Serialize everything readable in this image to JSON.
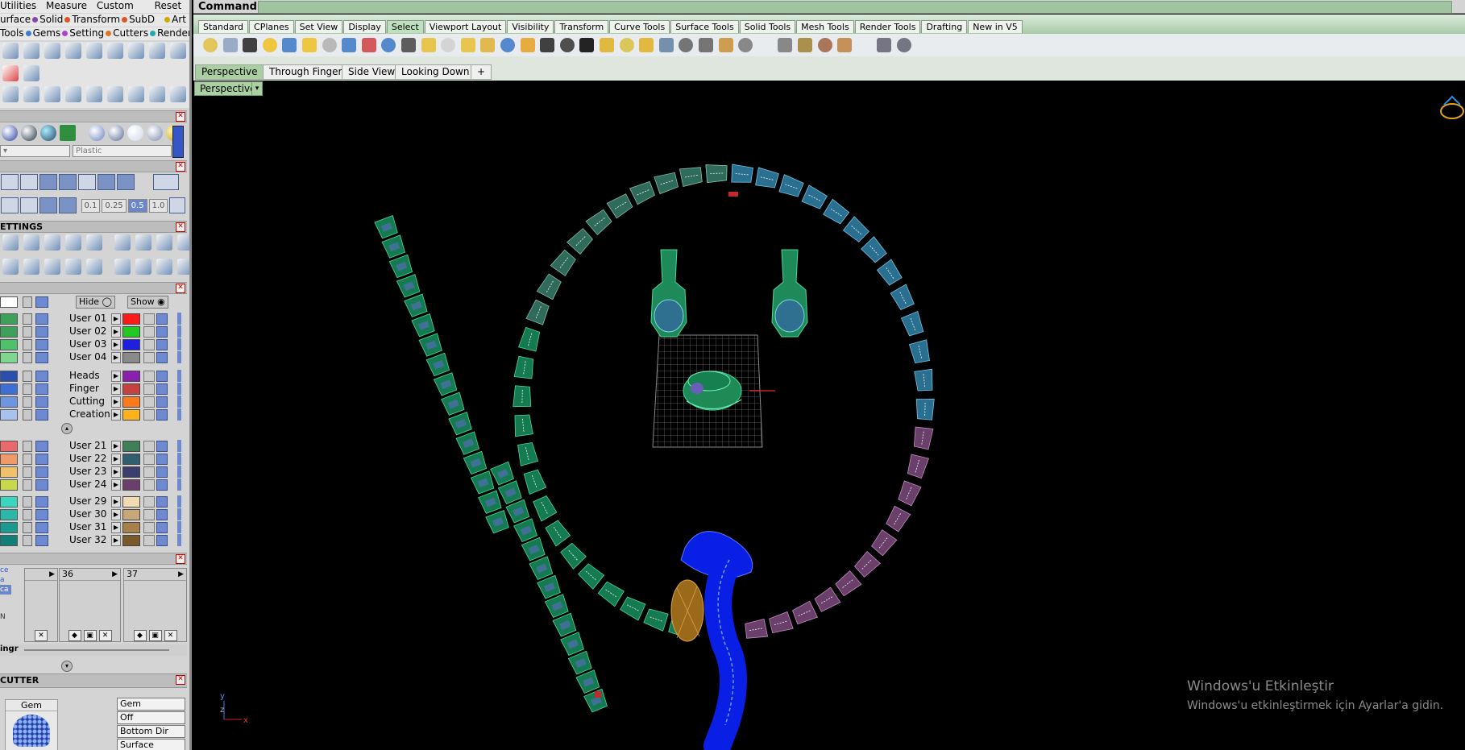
{
  "menu": {
    "row1": [
      "Utilities",
      "Measure",
      "Custom",
      "Reset"
    ],
    "row2": [
      "urface",
      "Solid",
      "Transform",
      "SubD",
      "Art"
    ],
    "row3": [
      "Tools",
      "Gems",
      "Setting",
      "Cutters",
      "Render"
    ]
  },
  "material": {
    "dropdown2": "Plastic"
  },
  "snap": {
    "values": [
      "0.1",
      "0.25",
      "0.5",
      "1.0"
    ],
    "selected": "0.5"
  },
  "sections": {
    "settings": "ETTINGS",
    "cutter": "CUTTER"
  },
  "layers": {
    "hide": "Hide",
    "show": "Show",
    "rows": [
      {
        "name": "User 01",
        "color": "#ff1a1a",
        "chip": "#3fa05a"
      },
      {
        "name": "User 02",
        "color": "#22c922",
        "chip": "#3fa05a"
      },
      {
        "name": "User 03",
        "color": "#1f1fe0",
        "chip": "#4fc16b"
      },
      {
        "name": "User 04",
        "color": "#8a8a8a",
        "chip": "#7fd68f"
      },
      {
        "name": "Heads",
        "color": "#8a1fb0",
        "chip": "#2b4fae"
      },
      {
        "name": "Finger",
        "color": "#c84040",
        "chip": "#3e6fd4"
      },
      {
        "name": "Cutting",
        "color": "#ff7a1a",
        "chip": "#6d95e2"
      },
      {
        "name": "Creation",
        "color": "#ffb21a",
        "chip": "#a8c2f0"
      },
      {
        "name": "User 21",
        "color": "#3f7f5a",
        "chip": "#e86a6a"
      },
      {
        "name": "User 22",
        "color": "#2f5f6f",
        "chip": "#f09a6a"
      },
      {
        "name": "User 23",
        "color": "#3a3f6f",
        "chip": "#f0c06a"
      },
      {
        "name": "User 24",
        "color": "#6a3f6a",
        "chip": "#c8d84a"
      },
      {
        "name": "User 29",
        "color": "#f0dcb0",
        "chip": "#3ad6c0"
      },
      {
        "name": "User 30",
        "color": "#c8a878",
        "chip": "#2ab8a8"
      },
      {
        "name": "User 31",
        "color": "#a8804a",
        "chip": "#1a9a90"
      },
      {
        "name": "User 32",
        "color": "#7a5a2a",
        "chip": "#0f7f78"
      }
    ]
  },
  "slots": {
    "left_labels": [
      "ce",
      "a",
      "ca",
      "N"
    ],
    "s1": "",
    "s2": "36",
    "s3": "37",
    "bottom_label": "ingr"
  },
  "cutter": {
    "preview_label": "Gem",
    "props": [
      "Gem",
      "Off",
      "Bottom Dir",
      "Surface"
    ]
  },
  "command": {
    "label": "Command:"
  },
  "toolbar_tabs": {
    "items": [
      "Standard",
      "CPlanes",
      "Set View",
      "Display",
      "Select",
      "Viewport Layout",
      "Visibility",
      "Transform",
      "Curve Tools",
      "Surface Tools",
      "Solid Tools",
      "Mesh Tools",
      "Render Tools",
      "Drafting",
      "New in V5"
    ],
    "active": "Select"
  },
  "view_tabs": {
    "items": [
      "Perspective",
      "Through Finger",
      "Side View",
      "Looking Down"
    ],
    "add": "+",
    "active": "Perspective"
  },
  "viewport": {
    "label": "Perspective",
    "axis_y": "y",
    "axis_z": "z",
    "axis_x": "x"
  },
  "watermark": {
    "line1": "Windows'u Etkinleştir",
    "line2": "Windows'u etkinleştirmek için Ayarlar'a gidin."
  }
}
